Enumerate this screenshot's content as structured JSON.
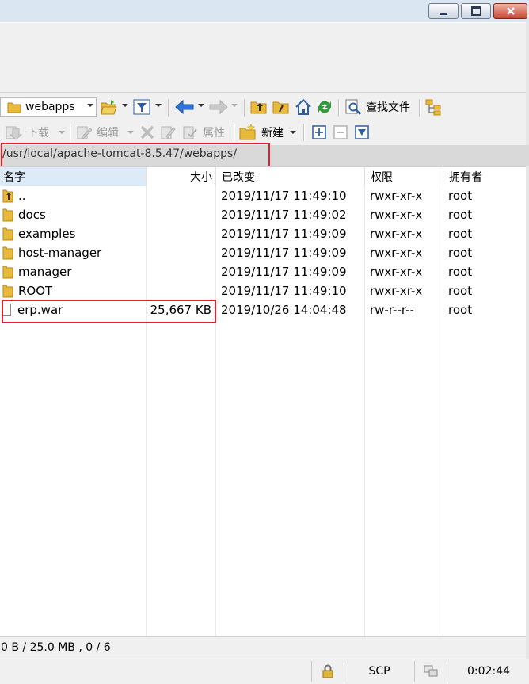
{
  "window": {
    "controls": [
      "minimize-icon",
      "restore-icon",
      "close-icon"
    ]
  },
  "toolbar1": {
    "location_label": "webapps",
    "find_label": "查找文件"
  },
  "toolbar2": {
    "download_label": "下载",
    "edit_label": "编辑",
    "properties_label": "属性",
    "new_label": "新建"
  },
  "path": {
    "value": "/usr/local/apache-tomcat-8.5.47/webapps/"
  },
  "columns": {
    "name": "名字",
    "size": "大小",
    "modified": "已改变",
    "permissions": "权限",
    "owner": "拥有者"
  },
  "files": [
    {
      "name": "..",
      "size": "",
      "modified": "2019/11/17 11:49:10",
      "permissions": "rwxr-xr-x",
      "owner": "root",
      "icon": "parent-folder-icon"
    },
    {
      "name": "docs",
      "size": "",
      "modified": "2019/11/17 11:49:02",
      "permissions": "rwxr-xr-x",
      "owner": "root",
      "icon": "folder-icon"
    },
    {
      "name": "examples",
      "size": "",
      "modified": "2019/11/17 11:49:09",
      "permissions": "rwxr-xr-x",
      "owner": "root",
      "icon": "folder-icon"
    },
    {
      "name": "host-manager",
      "size": "",
      "modified": "2019/11/17 11:49:09",
      "permissions": "rwxr-xr-x",
      "owner": "root",
      "icon": "folder-icon"
    },
    {
      "name": "manager",
      "size": "",
      "modified": "2019/11/17 11:49:09",
      "permissions": "rwxr-xr-x",
      "owner": "root",
      "icon": "folder-icon"
    },
    {
      "name": "ROOT",
      "size": "",
      "modified": "2019/11/17 11:49:10",
      "permissions": "rwxr-xr-x",
      "owner": "root",
      "icon": "folder-icon"
    },
    {
      "name": "erp.war",
      "size": "25,667 KB",
      "modified": "2019/10/26 14:04:48",
      "permissions": "rw-r--r--",
      "owner": "root",
      "icon": "file-icon"
    }
  ],
  "status": {
    "selection": "0 B / 25.0 MB ,  0 / 6",
    "protocol": "SCP",
    "elapsed": "0:02:44"
  },
  "colors": {
    "highlight_box": "#e0202a",
    "folder": "#e8b93b"
  }
}
